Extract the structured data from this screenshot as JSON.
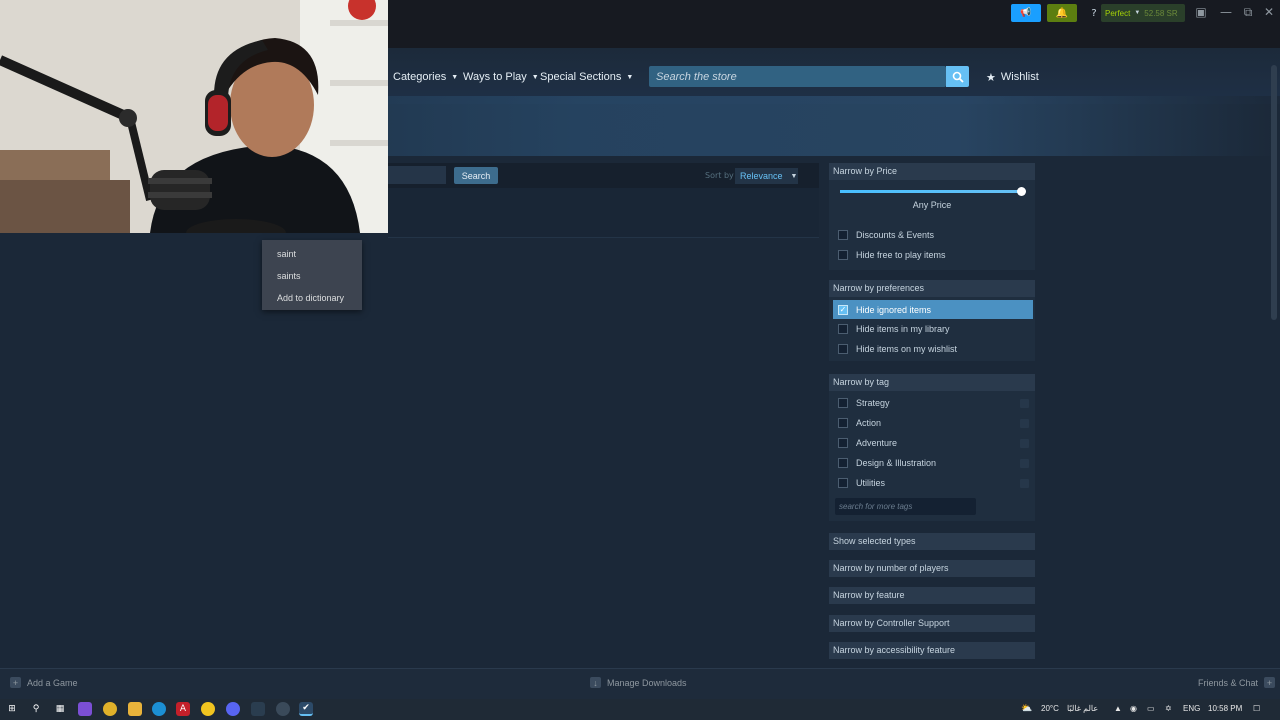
{
  "titlebar": {
    "status_label": "Perfect",
    "balance": "52.58 SR",
    "help": "?"
  },
  "nav": {
    "categories": "Categories",
    "ways_to_play": "Ways to Play",
    "special_sections": "Special Sections",
    "search_placeholder": "Search the store",
    "wishlist": "Wishlist"
  },
  "results": {
    "search_button": "Search",
    "sort_label": "Sort by",
    "sort_value": "Relevance"
  },
  "context_menu": {
    "items": [
      "saint",
      "saints",
      "Add to dictionary"
    ]
  },
  "sidebar": {
    "price": {
      "heading": "Narrow by Price",
      "value": "Any Price",
      "slider_fraction": 1.0,
      "options": [
        "Discounts & Events",
        "Hide free to play items"
      ]
    },
    "preferences": {
      "heading": "Narrow by preferences",
      "options": [
        {
          "label": "Hide ignored items",
          "checked": true
        },
        {
          "label": "Hide items in my library",
          "checked": false
        },
        {
          "label": "Hide items on my wishlist",
          "checked": false
        }
      ]
    },
    "tags": {
      "heading": "Narrow by tag",
      "options": [
        "Strategy",
        "Action",
        "Adventure",
        "Design & Illustration",
        "Utilities"
      ],
      "search_placeholder": "search for more tags"
    },
    "collapsed": [
      "Show selected types",
      "Narrow by number of players",
      "Narrow by feature",
      "Narrow by Controller Support",
      "Narrow by accessibility feature"
    ]
  },
  "bottombar": {
    "add_game": "Add a Game",
    "manage_downloads": "Manage Downloads",
    "friends_chat": "Friends & Chat"
  },
  "taskbar": {
    "weather": "20°C",
    "weather_text": "عالم غالبًا",
    "language": "ENG",
    "time": "10:58 PM"
  },
  "colors": {
    "accent": "#66c0f4",
    "background": "#1b2838",
    "green_button": "#5c7e10"
  }
}
